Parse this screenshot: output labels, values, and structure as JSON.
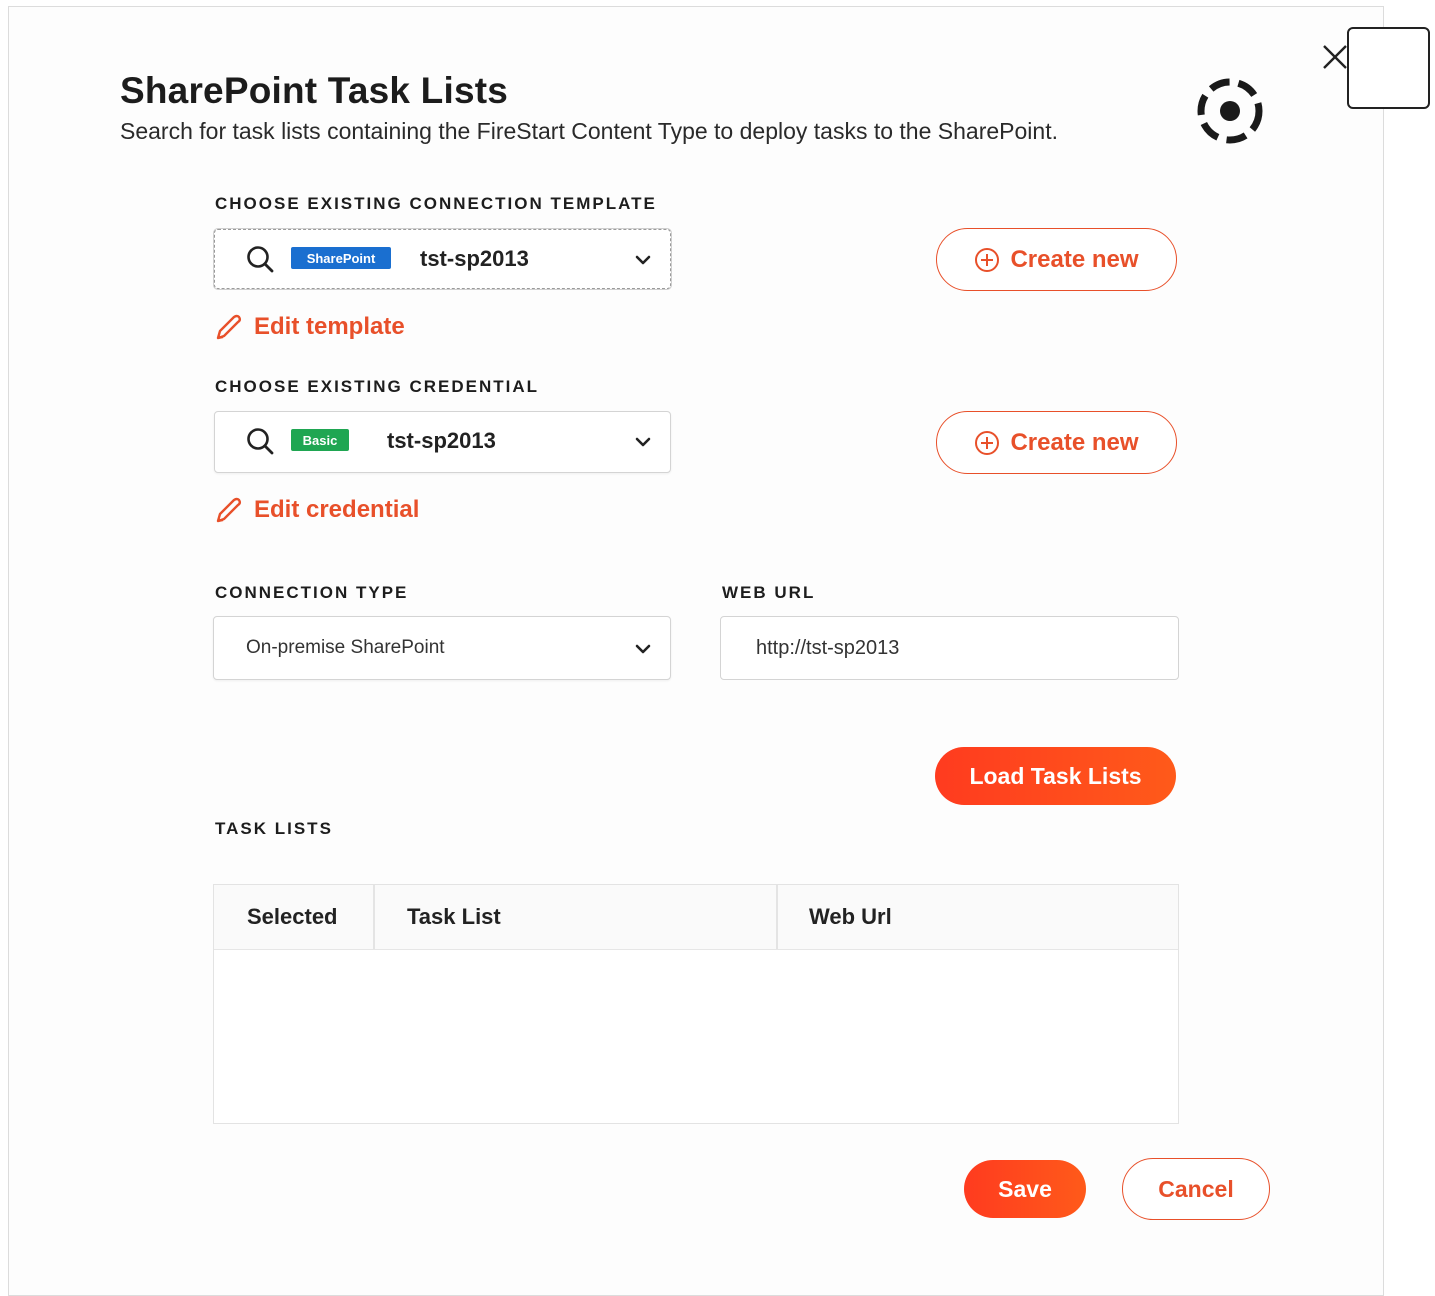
{
  "dialog": {
    "title": "SharePoint Task Lists",
    "subtitle": "Search for task lists containing the FireStart Content Type to deploy tasks to the SharePoint.",
    "icons": {
      "app": "target-icon",
      "close": "close-icon"
    }
  },
  "template_section": {
    "label": "CHOOSE EXISTING CONNECTION TEMPLATE",
    "badge": "SharePoint",
    "badge_color": "#1a6fd0",
    "selected": "tst-sp2013",
    "create_label": "Create new",
    "edit_label": "Edit template"
  },
  "credential_section": {
    "label": "CHOOSE EXISTING CREDENTIAL",
    "badge": "Basic",
    "badge_color": "#1fa652",
    "selected": "tst-sp2013",
    "create_label": "Create new",
    "edit_label": "Edit credential"
  },
  "connection": {
    "type_label": "CONNECTION TYPE",
    "type_value": "On-premise SharePoint",
    "url_label": "WEB URL",
    "url_value": "http://tst-sp2013"
  },
  "load_button": "Load Task Lists",
  "task_lists": {
    "label": "TASK LISTS",
    "columns": [
      "Selected",
      "Task List",
      "Web Url"
    ],
    "rows": []
  },
  "footer": {
    "save": "Save",
    "cancel": "Cancel"
  },
  "colors": {
    "accent": "#e8502a",
    "primary_button": "#ff4a1c"
  }
}
